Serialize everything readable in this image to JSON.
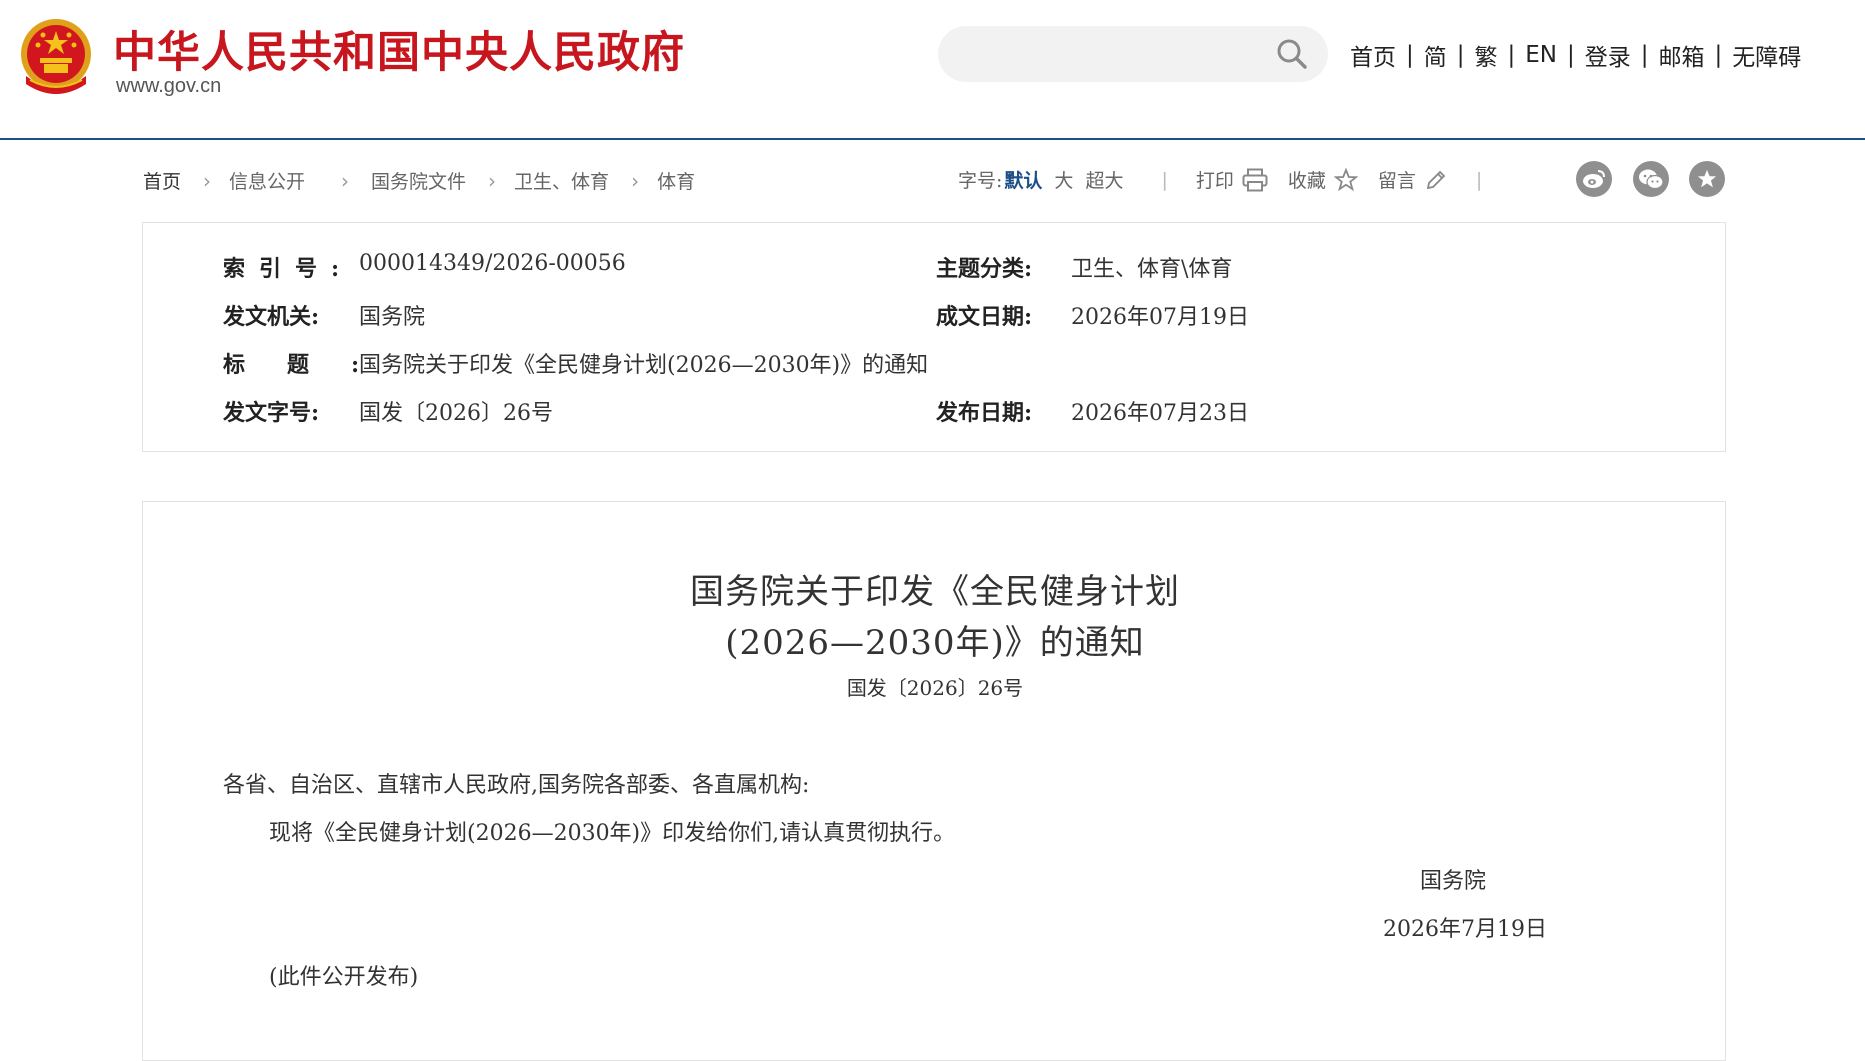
{
  "header": {
    "site_title": "中华人民共和国中央人民政府",
    "site_url": "www.gov.cn",
    "search": {
      "placeholder": "",
      "icon": "search-icon"
    },
    "nav": [
      "首页",
      "简",
      "繁",
      "EN",
      "登录",
      "邮箱",
      "无障碍"
    ],
    "colors": {
      "brand_red": "#c8161e",
      "accent_blue": "#1d4f86"
    }
  },
  "breadcrumb": [
    "首页",
    "信息公开",
    "国务院文件",
    "卫生、体育",
    "体育"
  ],
  "tools": {
    "font_size_label": "字号:",
    "font_sizes": [
      "默认",
      "大",
      "超大"
    ],
    "print": "打印",
    "favorite": "收藏",
    "comment": "留言",
    "share": [
      "weibo-icon",
      "wechat-icon",
      "favorite-star-icon"
    ]
  },
  "info": {
    "index_label": "索引号:",
    "index_value": "000014349/2026-00056",
    "topic_label": "主题分类:",
    "topic_value": "卫生、体育\\体育",
    "issuer_label": "发文机关:",
    "issuer_value": "国务院",
    "written_date_label": "成文日期:",
    "written_date_value": "2026年07月19日",
    "title_label": "标题:",
    "title_value": "国务院关于印发《全民健身计划(2026—2030年)》的通知",
    "doc_no_label": "发文字号:",
    "doc_no_value": "国发〔2026〕26号",
    "publish_date_label": "发布日期:",
    "publish_date_value": "2026年07月23日"
  },
  "article": {
    "title_line1": "国务院关于印发《全民健身计划",
    "title_line2": "(2026—2030年)》的通知",
    "doc_no": "国发〔2026〕26号",
    "salutation": "各省、自治区、直辖市人民政府,国务院各部委、各直属机构:",
    "body": "现将《全民健身计划(2026—2030年)》印发给你们,请认真贯彻执行。",
    "signature": "国务院",
    "date": "2026年7月19日",
    "note": "(此件公开发布)"
  }
}
